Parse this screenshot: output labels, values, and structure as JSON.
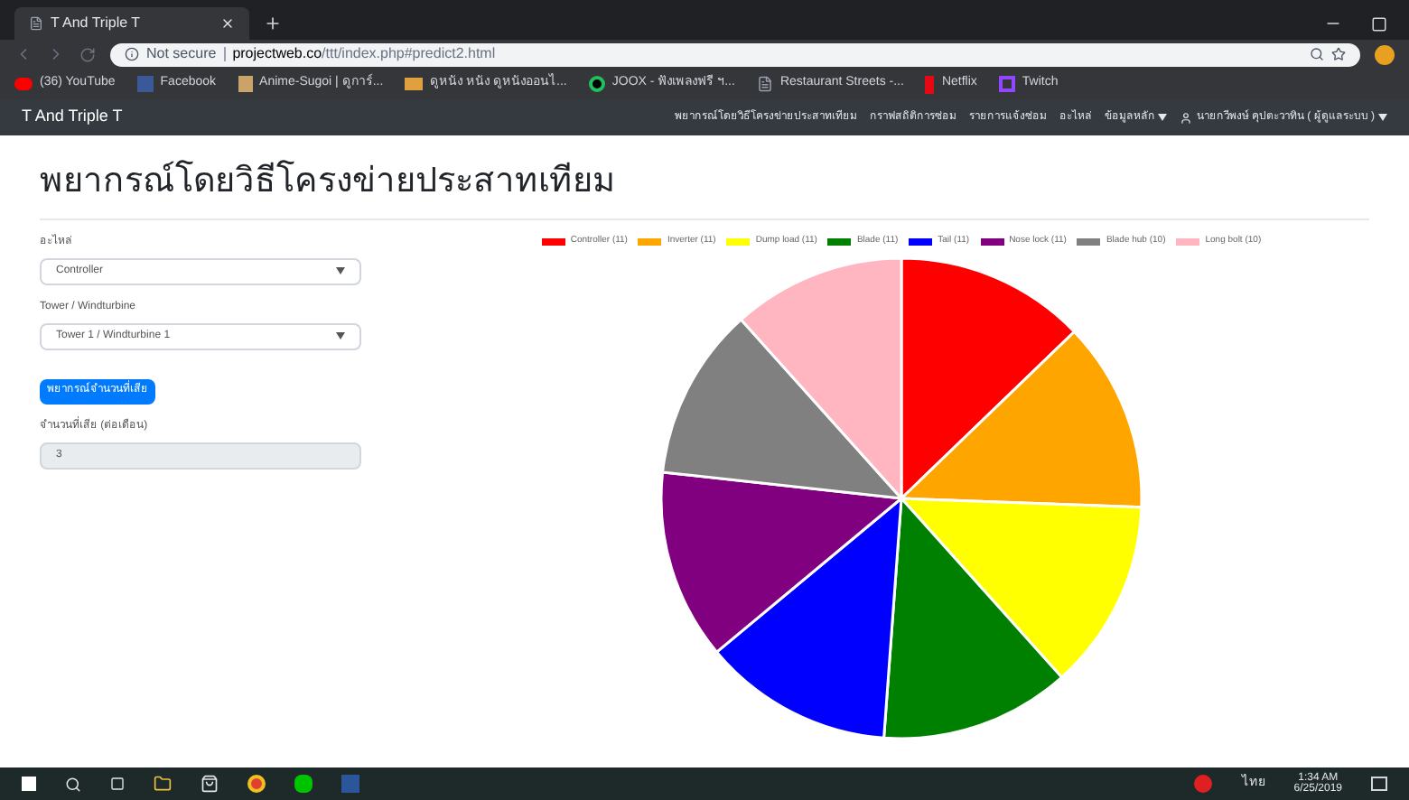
{
  "browser": {
    "tab_title": "T And Triple T",
    "security": "Not secure",
    "url_host": "projectweb.co",
    "url_path": "/ttt/index.php#predict2.html",
    "bookmarks": [
      {
        "kind": "youtube",
        "label": "(36) YouTube"
      },
      {
        "kind": "facebook",
        "label": "Facebook"
      },
      {
        "kind": "anime",
        "label": "Anime-Sugoi | ดูการ์..."
      },
      {
        "kind": "folder",
        "label": "ดูหนัง หนัง ดูหนังออนไ..."
      },
      {
        "kind": "joox",
        "label": "JOOX - ฟังเพลงฟรี ฯ..."
      },
      {
        "kind": "page",
        "label": "Restaurant Streets -..."
      },
      {
        "kind": "netflix",
        "label": "Netflix"
      },
      {
        "kind": "twitch",
        "label": "Twitch"
      }
    ]
  },
  "navbar": {
    "brand": "T And Triple T",
    "links": [
      {
        "label": "พยากรณ์โดยวิธีโครงข่ายประสาทเทียม",
        "dropdown": false
      },
      {
        "label": "กราฟสถิติการซ่อม",
        "dropdown": false
      },
      {
        "label": "รายการแจ้งซ่อม",
        "dropdown": false
      },
      {
        "label": "อะไหล่",
        "dropdown": false
      },
      {
        "label": "ข้อมูลหลัก",
        "dropdown": true
      }
    ],
    "user": "นายกวีพงษ์ คุปตะวาทิน ( ผู้ดูแลระบบ )"
  },
  "page": {
    "title": "พยากรณ์โดยวิธีโครงข่ายประสาทเทียม",
    "part_label": "อะไหล่",
    "part_value": "Controller",
    "tower_label": "Tower / Windturbine",
    "tower_value": "Tower 1 / Windturbine 1",
    "predict_button": "พยากรณ์จำนวนที่เสีย",
    "result_label": "จำนวนที่เสีย (ต่อเดือน)",
    "result_value": "3",
    "chart_data": {
      "type": "pie",
      "legend": true,
      "categories": [
        "Controller (11)",
        "Inverter (11)",
        "Dump load (11)",
        "Blade (11)",
        "Tail (11)",
        "Nose lock (11)",
        "Blade hub (10)",
        "Long bolt (10)"
      ],
      "series": [
        {
          "colors": [
            "#ff0000",
            "#ffa500",
            "#ffff00",
            "#008000",
            "#0000ff",
            "#800080",
            "#808080",
            "#ffb6c1"
          ],
          "values": [
            11,
            11,
            11,
            11,
            11,
            11,
            10,
            10
          ]
        }
      ]
    }
  },
  "taskbar": {
    "time": "1:34 AM",
    "date": "6/25/2019",
    "language": "ไทย"
  }
}
